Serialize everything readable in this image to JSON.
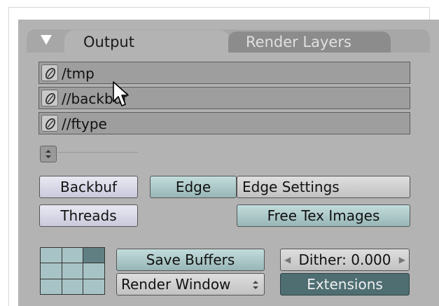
{
  "tabs": [
    {
      "label": "Output",
      "active": true
    },
    {
      "label": "Render Layers",
      "active": false
    }
  ],
  "paths": [
    {
      "value": "/tmp",
      "icon": "folder-icon"
    },
    {
      "value": "//backbuf",
      "icon": "folder-icon"
    },
    {
      "value": "//ftype",
      "icon": "folder-icon"
    }
  ],
  "buttons": {
    "backbuf": "Backbuf",
    "edge": "Edge",
    "edge_settings": "Edge Settings",
    "threads": "Threads",
    "free_tex": "Free Tex Images",
    "save_buffers": "Save Buffers",
    "render_window": "Render Window",
    "dither": "Dither: 0.000",
    "extensions": "Extensions"
  },
  "colors": {
    "panel": "#b3b3b3",
    "toggle_off": "#d9d9e8",
    "toggle_on": "#aec9c9",
    "extensions": "#4e6e72"
  }
}
